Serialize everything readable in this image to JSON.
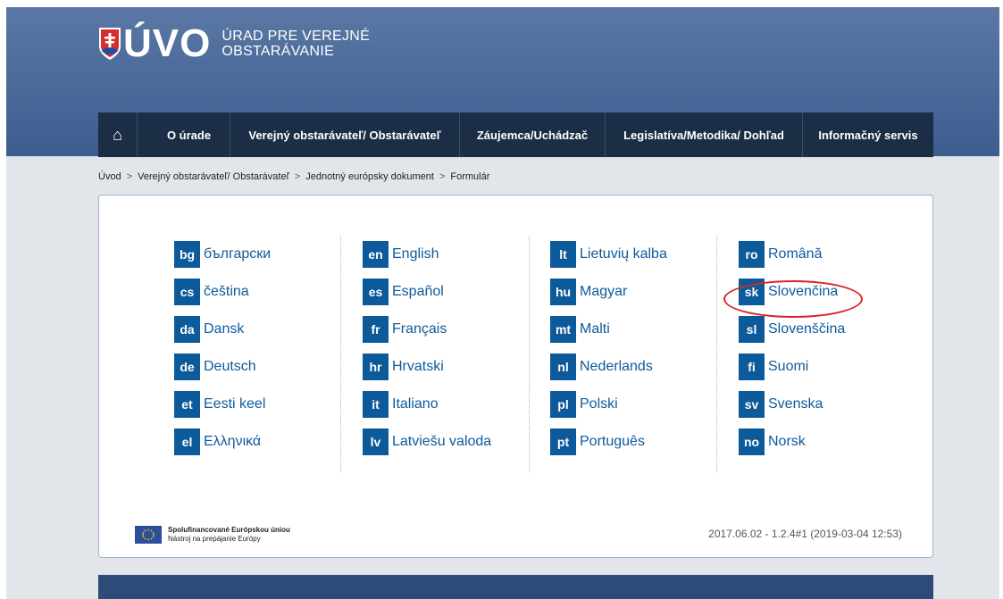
{
  "brand": {
    "logo_letters": "ÚVO",
    "logo_line1": "ÚRAD PRE VEREJNÉ",
    "logo_line2": "OBSTARÁVANIE"
  },
  "nav": {
    "home_icon": "⌂",
    "items": [
      "O úrade",
      "Verejný obstarávateľ/ Obstarávateľ",
      "Záujemca/Uchádzač",
      "Legislatíva/Metodika/ Dohľad",
      "Informačný servis"
    ]
  },
  "breadcrumb": [
    "Úvod",
    "Verejný obstarávateľ/ Obstarávateľ",
    "Jednotný európsky dokument",
    "Formulár"
  ],
  "breadcrumb_sep": ">",
  "languages": [
    [
      {
        "code": "bg",
        "name": "български"
      },
      {
        "code": "cs",
        "name": "čeština"
      },
      {
        "code": "da",
        "name": "Dansk"
      },
      {
        "code": "de",
        "name": "Deutsch"
      },
      {
        "code": "et",
        "name": "Eesti keel"
      },
      {
        "code": "el",
        "name": "Ελληνικά"
      }
    ],
    [
      {
        "code": "en",
        "name": "English"
      },
      {
        "code": "es",
        "name": "Español"
      },
      {
        "code": "fr",
        "name": "Français"
      },
      {
        "code": "hr",
        "name": "Hrvatski"
      },
      {
        "code": "it",
        "name": "Italiano"
      },
      {
        "code": "lv",
        "name": "Latviešu valoda"
      }
    ],
    [
      {
        "code": "lt",
        "name": "Lietuvių kalba"
      },
      {
        "code": "hu",
        "name": "Magyar"
      },
      {
        "code": "mt",
        "name": "Malti"
      },
      {
        "code": "nl",
        "name": "Nederlands"
      },
      {
        "code": "pl",
        "name": "Polski"
      },
      {
        "code": "pt",
        "name": "Português"
      }
    ],
    [
      {
        "code": "ro",
        "name": "Română"
      },
      {
        "code": "sk",
        "name": "Slovenčina"
      },
      {
        "code": "sl",
        "name": "Slovenščina"
      },
      {
        "code": "fi",
        "name": "Suomi"
      },
      {
        "code": "sv",
        "name": "Svenska"
      },
      {
        "code": "no",
        "name": "Norsk"
      }
    ]
  ],
  "footer": {
    "eu_line1": "Spolufinancované Európskou úniou",
    "eu_line2": "Nástroj na prepájanie Európy",
    "version": "2017.06.02 - 1.2.4#1 (2019-03-04 12:53)"
  },
  "colors": {
    "header": "#4a6898",
    "nav": "#1c2e45",
    "accent": "#0d5a9a",
    "highlight": "#d9232a"
  }
}
